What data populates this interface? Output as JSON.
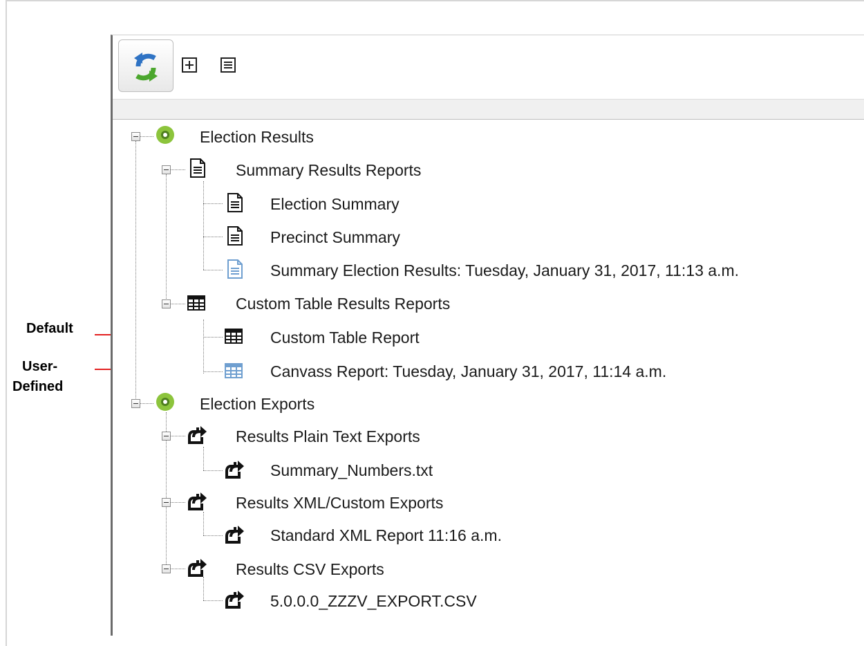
{
  "toolbar": {
    "refresh_button": "refresh",
    "expand_all": "expand-all",
    "collapse_all": "collapse-all"
  },
  "tree": {
    "election_results": {
      "label": "Election Results",
      "summary_results_reports": {
        "label": "Summary Results Reports",
        "items": [
          "Election Summary",
          "Precinct Summary",
          "Summary Election Results: Tuesday, January 31, 2017, 11:13 a.m."
        ]
      },
      "custom_table_results_reports": {
        "label": "Custom Table Results Reports",
        "items": [
          "Custom Table Report",
          "Canvass Report: Tuesday, January 31, 2017, 11:14 a.m."
        ]
      }
    },
    "election_exports": {
      "label": "Election Exports",
      "plain_text": {
        "label": "Results Plain Text Exports",
        "items": [
          "Summary_Numbers.txt"
        ]
      },
      "xml_custom": {
        "label": "Results XML/Custom Exports",
        "items": [
          "Standard XML Report 11:16 a.m."
        ]
      },
      "csv": {
        "label": "Results CSV Exports",
        "items": [
          "5.0.0.0_ZZZV_EXPORT.CSV"
        ]
      }
    }
  },
  "annotations": {
    "default": "Default",
    "user_defined_line1": "User-",
    "user_defined_line2": "Defined"
  },
  "colors": {
    "arrow": "#e32020",
    "root_icon": "#8cc43c",
    "user_defined_icon": "#6f9fd0"
  }
}
